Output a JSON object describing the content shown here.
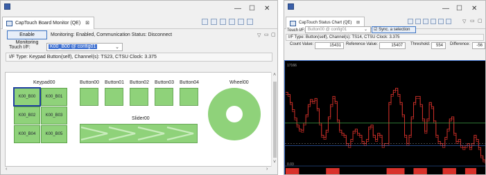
{
  "monitor": {
    "tab_title": "CapTouch Board Monitor (QE)",
    "tab_close": "⊠",
    "enable_button": "Enable Monitoring",
    "status_text": "Monitoring: Enabled, Communication Status: Disconnect",
    "touch_if_label": "Touch I/F:",
    "touch_if_value": "K00_B00 @ config01",
    "info_text": "I/F Type: Keypad Button(self), Channel(s): TS23, CTSU Clock: 3.375",
    "keypad_title": "Keypad00",
    "keys": [
      "K00_B00",
      "K00_B01",
      "K00_B02",
      "K00_B03",
      "K00_B04",
      "K00_B05"
    ],
    "buttons": [
      "Button00",
      "Button01",
      "Button02",
      "Button03",
      "Button04"
    ],
    "slider_label": "Slider00",
    "wheel_label": "Wheel00"
  },
  "chart_window": {
    "tab_title": "CapTouch Status Chart (QE)",
    "tab_close": "⊠",
    "touch_if_label": "Touch I/F:",
    "touch_if_value": "Button00 @ config01",
    "sync_label": "Sync. a selection",
    "info_text": "I/F Type: Button(self), Channel(s): TS14, CTSU Clock: 3.375",
    "count_label": "Count Value:",
    "count_value": "15431",
    "reference_label": "Reference Value:",
    "reference_value": "15407",
    "threshold_label": "Threshold:",
    "threshold_value": "554",
    "difference_label": "Difference:",
    "difference_value": "-56",
    "chart_top_label": "17166",
    "chart_bottom_label": "0.03"
  },
  "window_controls": {
    "minimize": "—",
    "maximize": "☐",
    "close": "✕"
  },
  "colors": {
    "accent_green": "#8fd27a",
    "selection_blue": "#3d6fd0",
    "chart_trace": "#d8322b",
    "chart_threshold": "#41a24a",
    "chart_bg": "#000000"
  },
  "chart_data": {
    "type": "line",
    "xlabel": "",
    "ylabel": "",
    "series": [
      {
        "values": [
          0.72,
          0.7,
          0.62,
          0.55,
          0.47,
          0.4,
          0.36,
          0.35,
          0.42,
          0.5,
          0.6,
          0.65,
          0.63,
          0.66,
          0.56,
          0.42,
          0.3,
          0.28,
          0.35,
          0.48,
          0.6,
          0.68,
          0.63,
          0.45,
          0.35,
          0.32,
          0.3,
          0.22,
          0.2,
          0.26,
          0.34,
          0.36,
          0.32,
          0.3,
          0.24,
          0.22,
          0.26,
          0.38,
          0.4,
          0.3,
          0.26,
          0.32,
          0.3,
          0.2,
          0.22,
          0.22,
          0.62,
          0.7,
          0.74,
          0.76,
          0.7,
          0.62,
          0.5,
          0.3,
          0.22,
          0.3,
          0.48,
          0.62,
          0.68,
          0.68,
          0.6,
          0.46,
          0.34,
          0.46,
          0.62,
          0.58,
          0.44,
          0.3,
          0.24,
          0.22,
          0.2,
          0.28,
          0.36,
          0.46,
          0.48,
          0.32,
          0.24,
          0.26,
          0.2,
          0.18,
          0.2,
          0.22,
          0.18,
          0.22,
          0.3,
          0.26,
          0.18,
          0.1,
          0.06,
          0.04
        ]
      },
      {
        "values": [
          0.7,
          0.68,
          0.6,
          0.53,
          0.45,
          0.38,
          0.34,
          0.33,
          0.4,
          0.48,
          0.58,
          0.63,
          0.61,
          0.64,
          0.54,
          0.4,
          0.28,
          0.26,
          0.33,
          0.46,
          0.58,
          0.66,
          0.61,
          0.43,
          0.33,
          0.3,
          0.28,
          0.2,
          0.18,
          0.24,
          0.32,
          0.34,
          0.3,
          0.28,
          0.22,
          0.2,
          0.24,
          0.36,
          0.38,
          0.28,
          0.24,
          0.3,
          0.28,
          0.18,
          0.2,
          0.2,
          0.6,
          0.68,
          0.72,
          0.74,
          0.68,
          0.6,
          0.48,
          0.28,
          0.2,
          0.28,
          0.46,
          0.6,
          0.66,
          0.66,
          0.58,
          0.44,
          0.32,
          0.44,
          0.6,
          0.56,
          0.42,
          0.28,
          0.22,
          0.2,
          0.18,
          0.26,
          0.34,
          0.44,
          0.46,
          0.3,
          0.22,
          0.24,
          0.18,
          0.16,
          0.18,
          0.2,
          0.16,
          0.2,
          0.28,
          0.24,
          0.16,
          0.08,
          0.04,
          0.02
        ]
      }
    ],
    "threshold": 0.42,
    "reference": 0.22,
    "touch_segments": [
      [
        0,
        6
      ],
      [
        18,
        24
      ],
      [
        45,
        53
      ],
      [
        57,
        63
      ],
      [
        70,
        76
      ],
      [
        80,
        85
      ]
    ],
    "ylim": [
      0,
      1
    ],
    "grid": false
  }
}
